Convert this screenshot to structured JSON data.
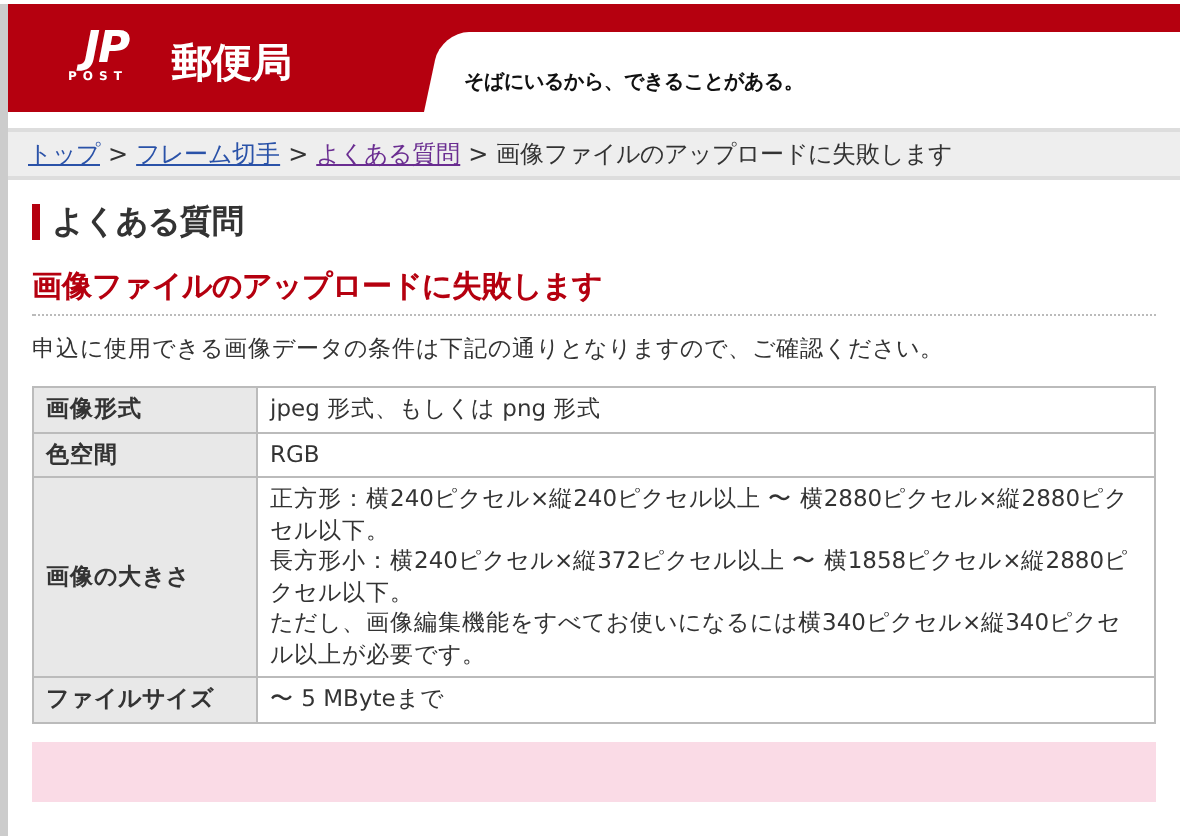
{
  "header": {
    "logo_mark": "JP",
    "logo_sub": "POST",
    "site_name": "郵便局",
    "tagline": "そばにいるから、できることがある。"
  },
  "breadcrumb": [
    {
      "label": "トップ",
      "kind": "link",
      "visited": false
    },
    {
      "label": "フレーム切手",
      "kind": "link",
      "visited": false
    },
    {
      "label": "よくある質問",
      "kind": "link",
      "visited": true
    },
    {
      "label": "画像ファイルのアップロードに失敗します",
      "kind": "current"
    }
  ],
  "breadcrumb_separator": ">",
  "section_heading": "よくある質問",
  "question_title": "画像ファイルのアップロードに失敗します",
  "intro": "申込に使用できる画像データの条件は下記の通りとなりますので、ご確認ください。",
  "table": {
    "rows": [
      {
        "label": "画像形式",
        "lines": [
          "jpeg 形式、もしくは png 形式"
        ]
      },
      {
        "label": "色空間",
        "lines": [
          "RGB"
        ]
      },
      {
        "label": "画像の大きさ",
        "lines": [
          "正方形：横240ピクセル×縦240ピクセル以上 〜 横2880ピクセル×縦2880ピクセル以下。",
          "長方形小：横240ピクセル×縦372ピクセル以上 〜 横1858ピクセル×縦2880ピクセル以下。",
          "ただし、画像編集機能をすべてお使いになるには横340ピクセル×縦340ピクセル以上が必要です。"
        ]
      },
      {
        "label": "ファイルサイズ",
        "lines": [
          "〜 5 MByteまで"
        ]
      }
    ]
  }
}
